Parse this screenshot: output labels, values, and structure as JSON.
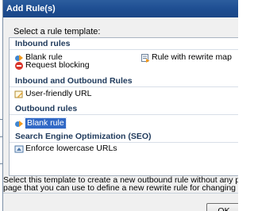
{
  "window": {
    "title": "Add Rule(s)"
  },
  "dialog": {
    "prompt": "Select a rule template:",
    "groups": [
      {
        "header": "Inbound rules",
        "items": [
          {
            "label": "Blank rule",
            "icon": "blank-rule-icon"
          },
          {
            "label": "Rule with rewrite map",
            "icon": "rewrite-map-icon"
          },
          {
            "label": "Request blocking",
            "icon": "request-blocking-icon"
          }
        ]
      },
      {
        "header": "Inbound and Outbound Rules",
        "items": [
          {
            "label": "User-friendly URL",
            "icon": "user-friendly-url-icon"
          }
        ]
      },
      {
        "header": "Outbound rules",
        "items": [
          {
            "label": "Blank rule",
            "icon": "blank-rule-icon",
            "selected": true
          }
        ]
      },
      {
        "header": "Search Engine Optimization (SEO)",
        "items": [
          {
            "label": "Enforce lowercase URLs",
            "icon": "lowercase-url-icon"
          }
        ]
      }
    ],
    "description_line1": "Select this template to create a new outbound rule without any preset values. This template op",
    "description_line2": "page that you can use to define a new rewrite rule for changing the content of an HTTP respon",
    "ok_label": "OK"
  },
  "colors": {
    "title_bar": "#1d4d91",
    "selection": "#3169c6",
    "group_header": "#1e395b"
  }
}
